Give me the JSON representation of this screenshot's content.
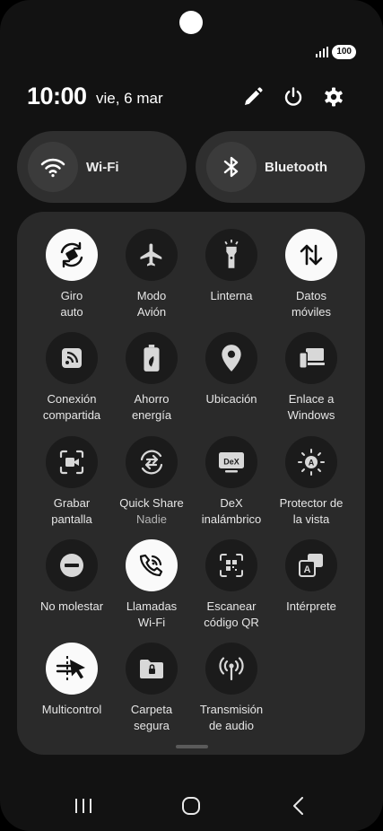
{
  "status": {
    "battery": "100"
  },
  "header": {
    "time": "10:00",
    "date": "vie, 6 mar"
  },
  "pills": [
    {
      "label": "Wi-Fi",
      "icon": "wifi-icon"
    },
    {
      "label": "Bluetooth",
      "icon": "bluetooth-icon"
    }
  ],
  "tiles": [
    {
      "label": "Giro\nauto",
      "icon": "auto-rotate-icon",
      "active": true
    },
    {
      "label": "Modo\nAvión",
      "icon": "airplane-icon",
      "active": false
    },
    {
      "label": "Linterna",
      "icon": "flashlight-icon",
      "active": false
    },
    {
      "label": "Datos\nmóviles",
      "icon": "mobile-data-icon",
      "active": true
    },
    {
      "label": "Conexión\ncompartida",
      "icon": "hotspot-icon",
      "active": false
    },
    {
      "label": "Ahorro\nenergía",
      "icon": "power-saving-icon",
      "active": false
    },
    {
      "label": "Ubicación",
      "icon": "location-icon",
      "active": false
    },
    {
      "label": "Enlace a\nWindows",
      "icon": "link-to-windows-icon",
      "active": false
    },
    {
      "label": "Grabar\npantalla",
      "icon": "screen-recorder-icon",
      "active": false
    },
    {
      "label": "Quick Share",
      "sub": "Nadie",
      "icon": "quick-share-icon",
      "active": false
    },
    {
      "label": "DeX\ninalámbrico",
      "icon": "dex-icon",
      "active": false
    },
    {
      "label": "Protector de\nla vista",
      "icon": "eye-comfort-icon",
      "active": false
    },
    {
      "label": "No molestar",
      "icon": "do-not-disturb-icon",
      "active": false
    },
    {
      "label": "Llamadas\nWi-Fi",
      "icon": "wifi-calling-icon",
      "active": true
    },
    {
      "label": "Escanear\ncódigo QR",
      "icon": "qr-scan-icon",
      "active": false
    },
    {
      "label": "Intérprete",
      "icon": "interpreter-icon",
      "active": false
    },
    {
      "label": "Multicontrol",
      "icon": "multi-control-icon",
      "active": true
    },
    {
      "label": "Carpeta\nsegura",
      "icon": "secure-folder-icon",
      "active": false
    },
    {
      "label": "Transmisión\nde audio",
      "icon": "audio-broadcast-icon",
      "active": false
    }
  ]
}
